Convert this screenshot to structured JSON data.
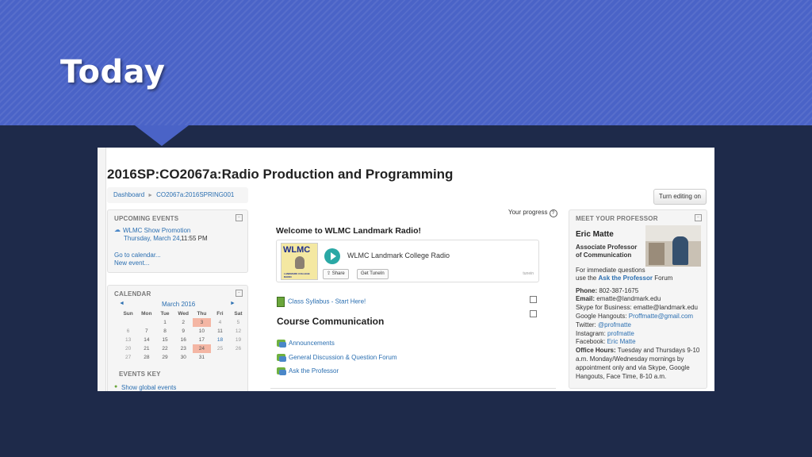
{
  "slide": {
    "title": "Today"
  },
  "course": {
    "title": "2016SP:CO2067a:Radio Production and Programming",
    "breadcrumb": [
      "Dashboard",
      "CO2067a:2016SPRING001"
    ],
    "edit_button": "Turn editing on"
  },
  "upcoming": {
    "heading": "UPCOMING EVENTS",
    "event_title": "WLMC Show Promotion",
    "event_date": "Thursday, March 24,",
    "event_time": "11:55 PM",
    "link_calendar": "Go to calendar...",
    "link_new": "New event..."
  },
  "calendar": {
    "heading": "CALENDAR",
    "prev": "◄",
    "month": "March 2016",
    "next": "►",
    "days": [
      "Sun",
      "Mon",
      "Tue",
      "Wed",
      "Thu",
      "Fri",
      "Sat"
    ],
    "weeks": [
      [
        "",
        "",
        "1",
        "2",
        "3",
        "4",
        "5"
      ],
      [
        "6",
        "7",
        "8",
        "9",
        "10",
        "11",
        "12"
      ],
      [
        "13",
        "14",
        "15",
        "16",
        "17",
        "18",
        "19"
      ],
      [
        "20",
        "21",
        "22",
        "23",
        "24",
        "25",
        "26"
      ],
      [
        "27",
        "28",
        "29",
        "30",
        "31",
        "",
        ""
      ]
    ],
    "events_key": "EVENTS KEY",
    "show_global": "Show global events"
  },
  "main": {
    "progress_label": "Your progress",
    "welcome": "Welcome to WLMC Landmark Radio!",
    "player": {
      "logo_text": "WLMC",
      "logo_sub": "LANDMARK COLLEGE RADIO",
      "station": "WLMC Landmark College Radio",
      "share": "Share",
      "get_tunein": "Get TuneIn",
      "brand": "tunein"
    },
    "syllabus": "Class Syllabus - Start Here!",
    "section_title": "Course Communication",
    "forums": [
      "Announcements",
      "General Discussion & Question Forum",
      "Ask the Professor"
    ]
  },
  "professor": {
    "heading": "MEET YOUR PROFESSOR",
    "name": "Eric Matte",
    "title_line1": "Associate Professor",
    "title_line2": "of Communication",
    "immediate_line1": "For immediate questions",
    "immediate_pre": "use the",
    "immediate_link": "Ask the Professor",
    "immediate_post": "Forum",
    "phone_label": "Phone:",
    "phone": "802-387-1675",
    "email_label": "Email:",
    "email": "ematte@landmark.edu",
    "skype": "Skype for Business: ematte@landmark.edu",
    "hangouts_label": "Google Hangouts:",
    "hangouts": "Proffmatte@gmail.com",
    "twitter_label": "Twitter:",
    "twitter": "@profmatte",
    "instagram_label": "Instagram:",
    "instagram": "profmatte",
    "facebook_label": "Facebook:",
    "facebook": "Eric Matte",
    "office_label": "Office Hours:",
    "office_line1": "Tuesday and Thursdays  9-10",
    "office_line2": "a.m. Monday/Wednesday mornings by",
    "office_line3": "appointment only and via Skype, Google",
    "office_line4": "Hangouts, Face Time, 8-10 a.m."
  }
}
